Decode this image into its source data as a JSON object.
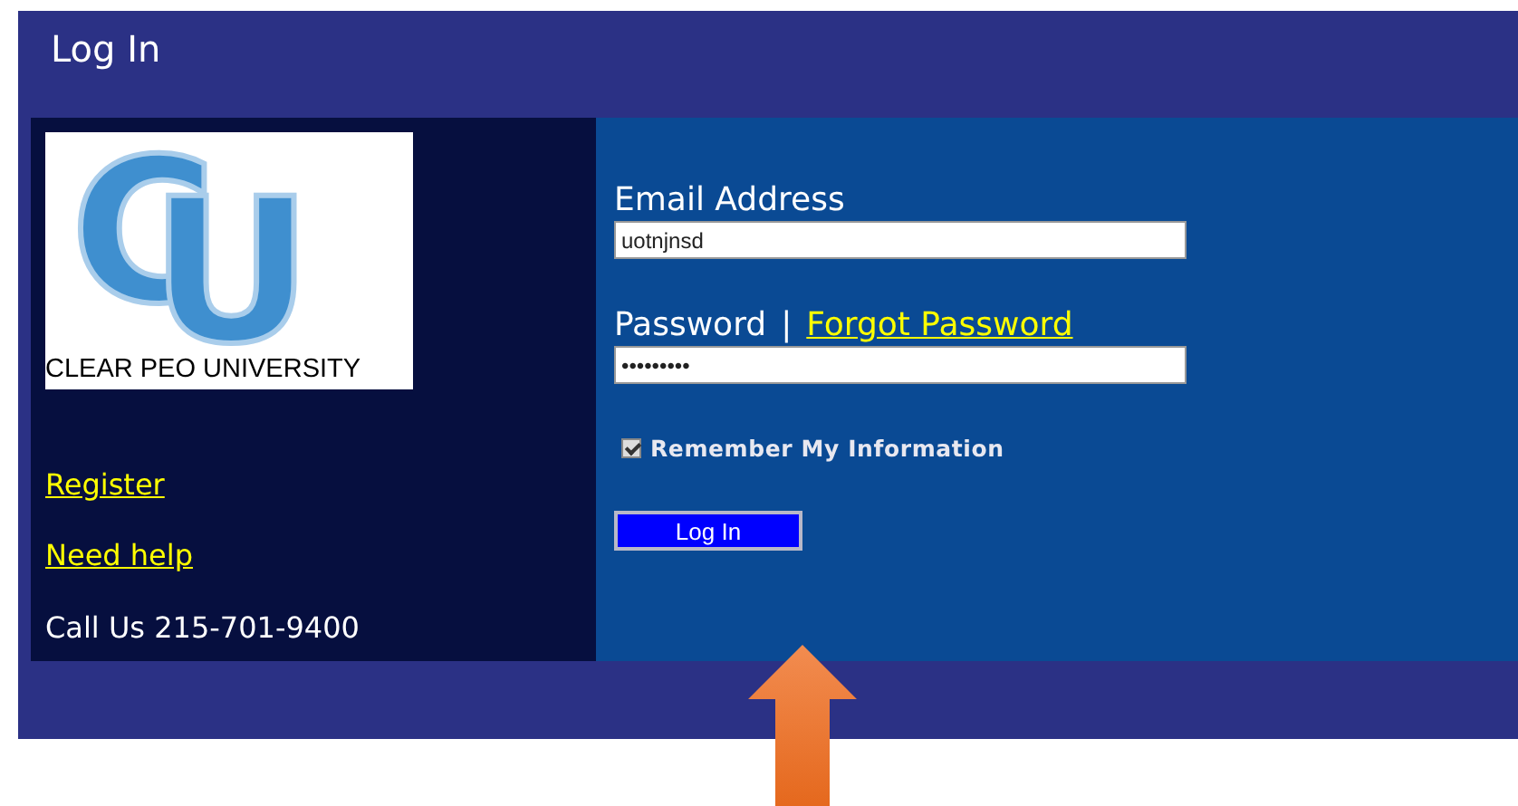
{
  "window": {
    "title": "Log In"
  },
  "logo": {
    "monogram": [
      "C",
      "U"
    ],
    "caption": "CLEAR PEO UNIVERSITY"
  },
  "sidebar": {
    "links": [
      "Register",
      "Need help"
    ],
    "contact": "Call Us 215-701-9400"
  },
  "form": {
    "email": {
      "label": "Email Address",
      "value": "uotnjnsd"
    },
    "password": {
      "label": "Password",
      "separator": "|",
      "forgot_link": "Forgot Password",
      "value": "•••••••••"
    },
    "remember": {
      "label": "Remember My Information",
      "checked": true
    },
    "submit": "Log In"
  }
}
